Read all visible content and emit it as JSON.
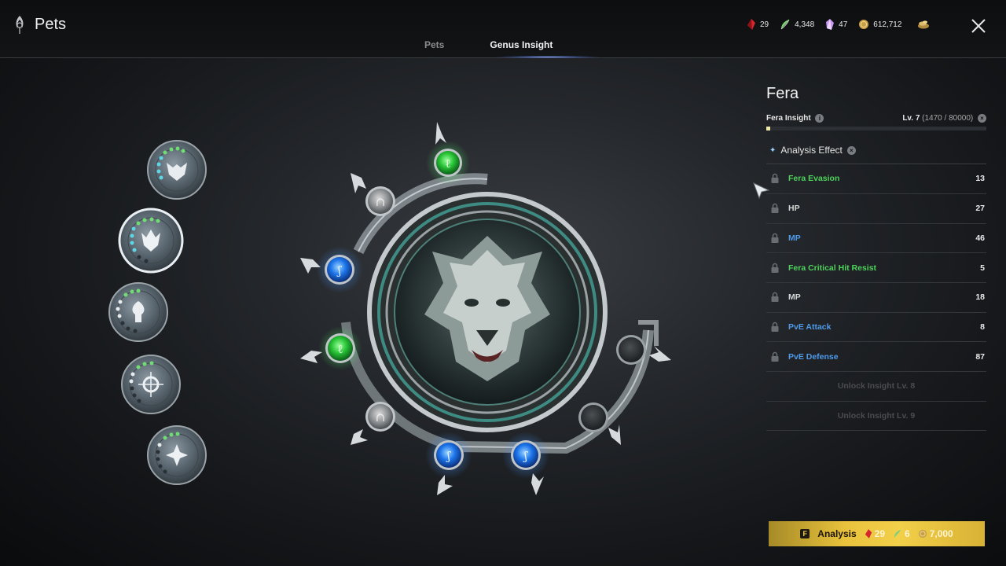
{
  "window": {
    "title": "Pets"
  },
  "tabs": [
    {
      "label": "Pets",
      "active": false
    },
    {
      "label": "Genus Insight",
      "active": true
    }
  ],
  "currencies": [
    {
      "icon": "red-crystal-icon",
      "value": "29",
      "color": "#e0333b"
    },
    {
      "icon": "feather-icon",
      "value": "4,348",
      "color": "#8fd48a"
    },
    {
      "icon": "pink-gem-icon",
      "value": "47",
      "color": "#d9a6ff"
    },
    {
      "icon": "gold-coin-icon",
      "value": "612,712",
      "color": "#c9a54a"
    },
    {
      "icon": "coin-pile-icon",
      "value": "",
      "color": "#c9a54a"
    }
  ],
  "genus_list": [
    {
      "name": "wolf-mask",
      "selected": false
    },
    {
      "name": "fera",
      "selected": true
    },
    {
      "name": "tree",
      "selected": false
    },
    {
      "name": "orb",
      "selected": false
    },
    {
      "name": "star-flower",
      "selected": false
    }
  ],
  "emblem": {
    "nodes": [
      {
        "kind": "green",
        "glyph": "ℓ"
      },
      {
        "kind": "gray",
        "glyph": "∩"
      },
      {
        "kind": "blue",
        "glyph": "ʃ"
      },
      {
        "kind": "green",
        "glyph": "ℓ"
      },
      {
        "kind": "gray",
        "glyph": "∩"
      },
      {
        "kind": "blue",
        "glyph": "ʃ"
      },
      {
        "kind": "blue",
        "glyph": "ʃ"
      },
      {
        "kind": "dark",
        "glyph": ""
      },
      {
        "kind": "dark",
        "glyph": ""
      }
    ]
  },
  "panel": {
    "title": "Fera",
    "insight_label": "Fera Insight",
    "level": "Lv. 7",
    "exp": "(1470 / 80000)",
    "exp_progress": 0.018,
    "analysis_effect_label": "Analysis Effect",
    "effects": [
      {
        "name": "Fera Evasion",
        "value": "13",
        "color": "green"
      },
      {
        "name": "HP",
        "value": "27",
        "color": "white"
      },
      {
        "name": "MP",
        "value": "46",
        "color": "blue"
      },
      {
        "name": "Fera Critical Hit Resist",
        "value": "5",
        "color": "green"
      },
      {
        "name": "MP",
        "value": "18",
        "color": "white"
      },
      {
        "name": "PvE Attack",
        "value": "8",
        "color": "blue"
      },
      {
        "name": "PvE Defense",
        "value": "87",
        "color": "blue"
      }
    ],
    "locked": [
      "Unlock Insight Lv. 8",
      "Unlock Insight Lv. 9"
    ]
  },
  "analysis_button": {
    "key": "F",
    "label": "Analysis",
    "costs": [
      {
        "icon": "red-crystal-icon",
        "value": "29"
      },
      {
        "icon": "feather-icon",
        "value": "6"
      },
      {
        "icon": "gold-coin-icon",
        "value": "7,000"
      }
    ]
  }
}
